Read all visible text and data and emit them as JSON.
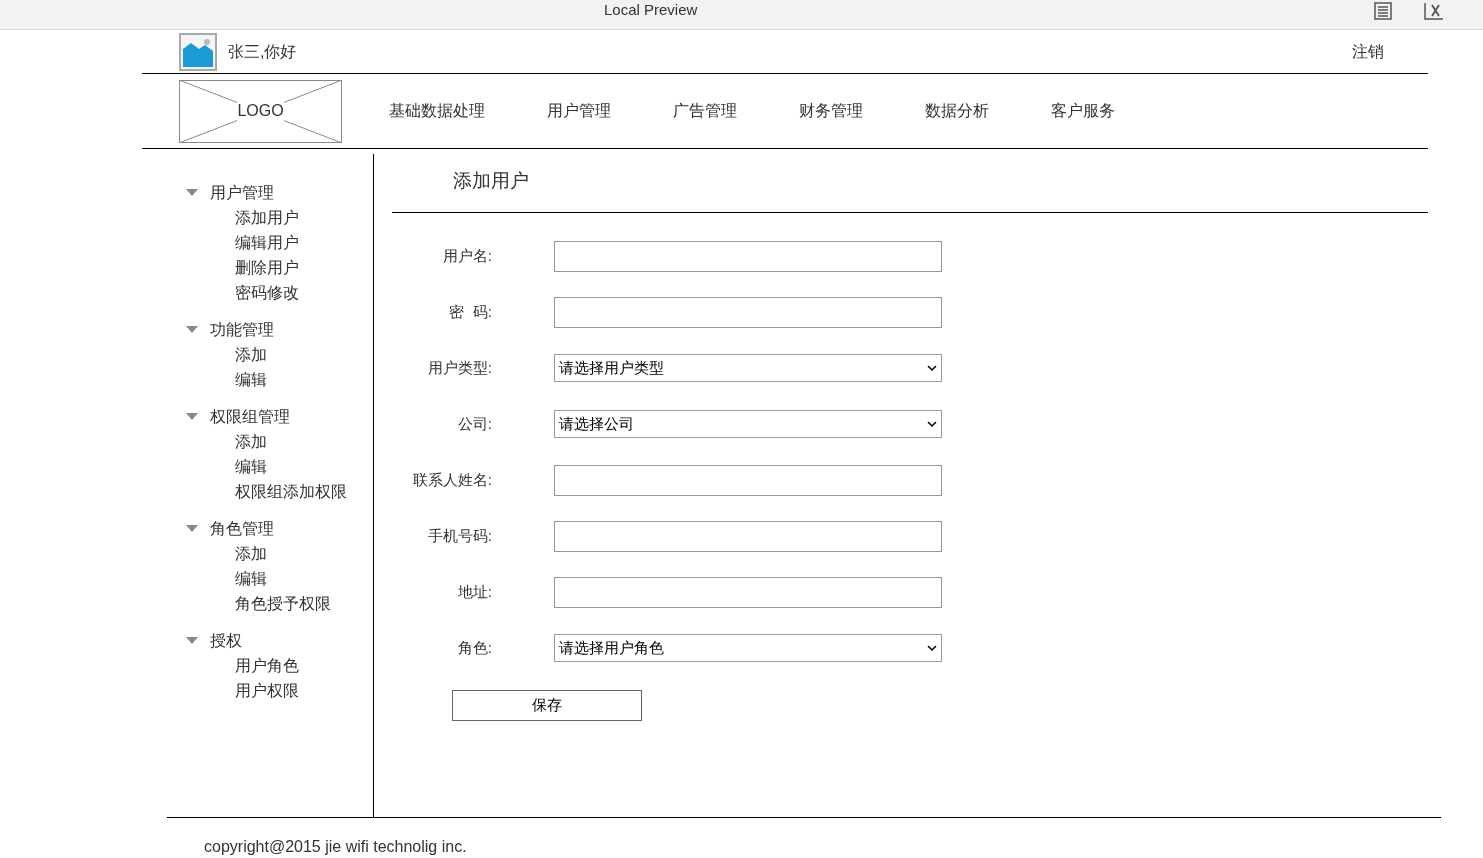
{
  "window": {
    "title": "Local Preview"
  },
  "header": {
    "greeting": "张三,你好",
    "logout": "注销"
  },
  "logo": "LOGO",
  "nav": [
    {
      "label": "基础数据处理"
    },
    {
      "label": "用户管理"
    },
    {
      "label": "广告管理"
    },
    {
      "label": "财务管理"
    },
    {
      "label": "数据分析"
    },
    {
      "label": "客户服务"
    }
  ],
  "sidebar": {
    "items": [
      {
        "label": "用户管理",
        "expanded": true,
        "children": [
          {
            "label": "添加用户"
          },
          {
            "label": "编辑用户"
          },
          {
            "label": "删除用户"
          },
          {
            "label": "密码修改"
          }
        ]
      },
      {
        "label": "功能管理",
        "expanded": true,
        "children": [
          {
            "label": "添加"
          },
          {
            "label": "编辑"
          }
        ]
      },
      {
        "label": "权限组管理",
        "expanded": true,
        "children": [
          {
            "label": "添加"
          },
          {
            "label": "编辑"
          },
          {
            "label": "权限组添加权限"
          }
        ]
      },
      {
        "label": "角色管理",
        "expanded": true,
        "children": [
          {
            "label": "添加"
          },
          {
            "label": "编辑"
          },
          {
            "label": "角色授予权限"
          }
        ]
      },
      {
        "label": "授权",
        "expanded": true,
        "children": [
          {
            "label": "用户角色"
          },
          {
            "label": "用户权限"
          }
        ]
      }
    ]
  },
  "page_title": "添加用户",
  "form": {
    "fields": [
      {
        "kind": "text",
        "label": "用户名:"
      },
      {
        "kind": "text",
        "label": "密  码:"
      },
      {
        "kind": "select",
        "label": "用户类型:",
        "value": "请选择用户类型"
      },
      {
        "kind": "select",
        "label": "公司:",
        "value": "请选择公司"
      },
      {
        "kind": "text",
        "label": "联系人姓名:"
      },
      {
        "kind": "text",
        "label": "手机号码:"
      },
      {
        "kind": "text",
        "label": "地址:"
      },
      {
        "kind": "select",
        "label": "角色:",
        "value": "请选择用户角色"
      }
    ],
    "submit": "保存"
  },
  "footer": "copyright@2015 jie wifi technolig inc."
}
